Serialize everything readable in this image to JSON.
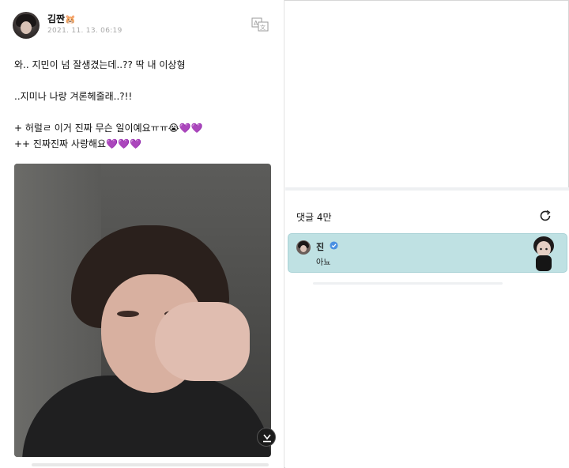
{
  "post": {
    "author": "김짠",
    "author_emoji": "🐹",
    "date": "2021. 11. 13. 06:19",
    "lines": [
      "와.. 지민이 넘 잘생겼는데..?? 딱 내 이상형",
      "..지미나 나랑 겨론헤줄래..?!!",
      "+ 허럴ㄹ 이거 진짜 무슨 일이예요ㅠㅠ😭",
      "++ 진짜진짜 사랑해요"
    ],
    "hearts_line3": "💜💜",
    "hearts_line4": "💜💜💜"
  },
  "comments": {
    "title": "댓글 4만",
    "items": [
      {
        "name": "진",
        "text": "아뇨"
      }
    ]
  },
  "colors": {
    "comment_highlight": "#bfe1e3",
    "heart": "#8a3fd6",
    "verified": "#4a90e2"
  },
  "icons": [
    "translate-icon",
    "download-icon",
    "refresh-icon",
    "verified-icon"
  ]
}
